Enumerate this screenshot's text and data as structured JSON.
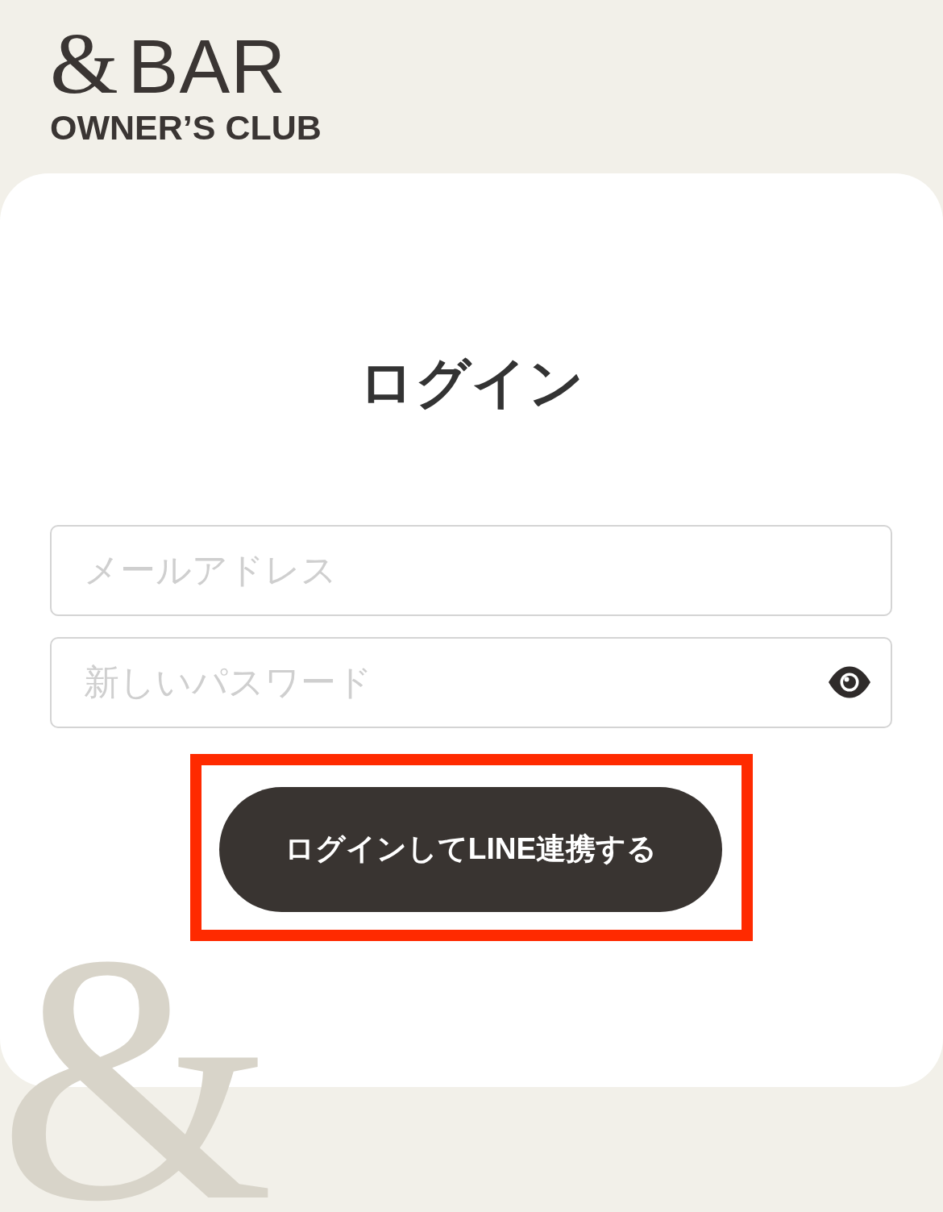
{
  "logo": {
    "mark": "&",
    "name": "BAR",
    "tagline": "OWNER’S CLUB"
  },
  "title": "ログイン",
  "form": {
    "fields": [
      {
        "placeholder": "メールアドレス",
        "reveal_toggle": false
      },
      {
        "placeholder": "新しいパスワード",
        "reveal_toggle": true
      }
    ],
    "submit": {
      "label": "ログインしてLINE連携する",
      "highlighted": true
    }
  },
  "decoration": {
    "glyph": "&"
  }
}
